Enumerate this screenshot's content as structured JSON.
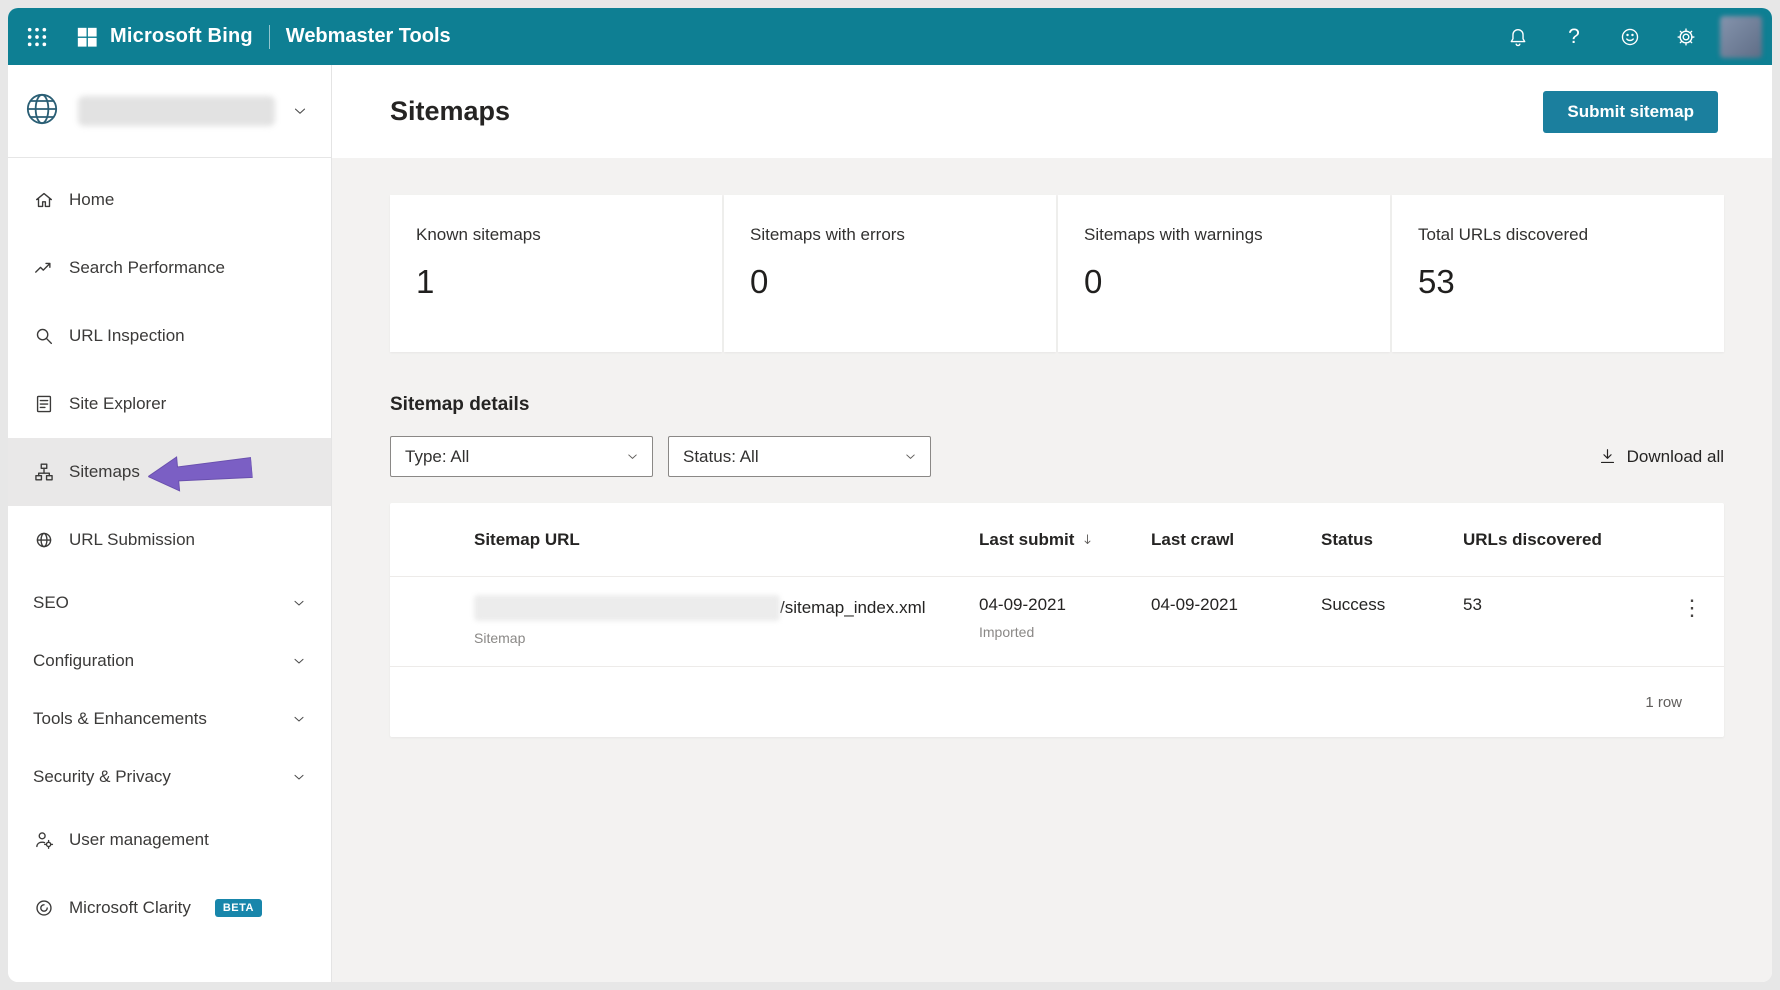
{
  "colors": {
    "topbar_teal": "#0e7f93",
    "button_teal": "#1b7f9e",
    "beta_badge": "#1886ab",
    "annotation_arrow": "#7b5fc4",
    "selected_item_bg": "#e9e8e8",
    "content_bg": "#f3f2f1"
  },
  "glyphs": {
    "help": "?",
    "kebab": "⋮"
  },
  "topbar": {
    "brand": "Microsoft Bing",
    "product": "Webmaster Tools",
    "icons": [
      "waffle-icon",
      "microsoft-logo-icon",
      "bell-icon",
      "help-icon",
      "smiley-icon",
      "gear-icon",
      "avatar"
    ]
  },
  "sidebar": {
    "site_selector": {
      "icon": "globe-icon",
      "site_name_blurred": true
    },
    "items": [
      {
        "label": "Home",
        "icon": "home-icon"
      },
      {
        "label": "Search Performance",
        "icon": "trend-up-icon"
      },
      {
        "label": "URL Inspection",
        "icon": "search-icon"
      },
      {
        "label": "Site Explorer",
        "icon": "site-explorer-icon"
      },
      {
        "label": "Sitemaps",
        "icon": "sitemap-icon",
        "selected": true
      },
      {
        "label": "URL Submission",
        "icon": "globe-icon"
      },
      {
        "label": "SEO",
        "expandable": true
      },
      {
        "label": "Configuration",
        "expandable": true
      },
      {
        "label": "Tools & Enhancements",
        "expandable": true
      },
      {
        "label": "Security & Privacy",
        "expandable": true
      },
      {
        "label": "User management",
        "icon": "person-gear-icon"
      },
      {
        "label": "Microsoft Clarity",
        "icon": "clarity-icon",
        "badge": "BETA"
      }
    ]
  },
  "main": {
    "title": "Sitemaps",
    "submit_button": "Submit sitemap",
    "stats": [
      {
        "label": "Known sitemaps",
        "value": "1"
      },
      {
        "label": "Sitemaps with errors",
        "value": "0"
      },
      {
        "label": "Sitemaps with warnings",
        "value": "0"
      },
      {
        "label": "Total URLs discovered",
        "value": "53"
      }
    ],
    "section_title": "Sitemap details",
    "filters": {
      "type": "Type: All",
      "status": "Status: All",
      "download_all": "Download all"
    },
    "table": {
      "columns": [
        "Sitemap URL",
        "Last submit",
        "Last crawl",
        "Status",
        "URLs discovered"
      ],
      "sorted_column": "Last submit",
      "rows": [
        {
          "url_prefix_blurred": true,
          "url_suffix": "/sitemap_index.xml",
          "type": "Sitemap",
          "last_submit": "04-09-2021",
          "last_submit_note": "Imported",
          "last_crawl": "04-09-2021",
          "status": "Success",
          "urls_discovered": "53"
        }
      ],
      "footer": "1 row"
    }
  }
}
